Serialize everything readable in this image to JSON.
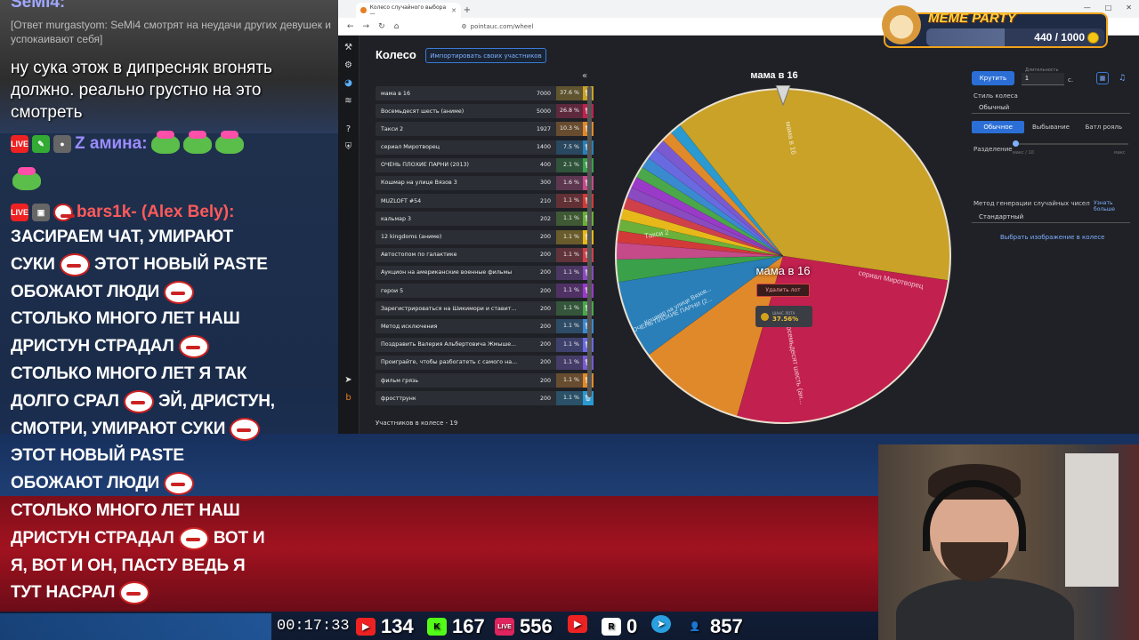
{
  "chat": {
    "top_user": "SeMi4:",
    "reply_text": "[Ответ murgastyom: SeMi4 смотрят на неудачи других девушек и успокаивают себя]",
    "message1": "ну сука этож в дипреcняк вгонять должно. реально грустно на это смотреть",
    "user2_name": "Z амина:",
    "user3_name": "bars1k- (Alex Bely):",
    "pasta_parts": [
      "ЗАСИРАЕМ ЧАТ, УМИРАЮТ СУКИ",
      "ЭТОТ НОВЫЙ PASTE ОБОЖАЮТ ЛЮДИ",
      "СТОЛЬКО МНОГО ЛЕТ НАШ ДРИСТУН СТРАДАЛ",
      "СТОЛЬКО МНОГО ЛЕТ Я ТАК ДОЛГО СРАЛ",
      "ЭЙ, ДРИСТУН, СМОТРИ, УМИРАЮТ СУКИ",
      "ЭТОТ НОВЫЙ PASTE ОБОЖАЮТ ЛЮДИ",
      "СТОЛЬКО МНОГО ЛЕТ НАШ ДРИСТУН СТРАДАЛ",
      "ВОТ И Я, ВОТ И ОН, ПАСТУ ВЕДЬ Я ТУТ НАСРАЛ"
    ]
  },
  "browser": {
    "tab_title": "Колесо случайного выбора —",
    "url": "pointauc.com/wheel"
  },
  "wheel_page": {
    "title": "Колесо",
    "import_button": "Импортировать своих участников",
    "participants_count": "Участников в колесе - 19",
    "lots": [
      {
        "name": "мама в 16",
        "value": "7000",
        "pct": "37.6 %",
        "color": "#c9a227"
      },
      {
        "name": "Восемьдесят шесть (аниме)",
        "value": "5000",
        "pct": "26.8 %",
        "color": "#c2204f"
      },
      {
        "name": "Такси 2",
        "value": "1927",
        "pct": "10.3 %",
        "color": "#e0892a"
      },
      {
        "name": "сериал Миротворец",
        "value": "1400",
        "pct": "7.5 %",
        "color": "#2a7fb8"
      },
      {
        "name": "ОЧЕНЬ ПЛОХИЕ ПАРНИ (2013)",
        "value": "400",
        "pct": "2.1 %",
        "color": "#3aa04a"
      },
      {
        "name": "Кошмар на улице Вязов 3",
        "value": "300",
        "pct": "1.6 %",
        "color": "#c44a8a"
      },
      {
        "name": "MUZLOFT #54",
        "value": "210",
        "pct": "1.1 %",
        "color": "#d23a3a"
      },
      {
        "name": "кальмар 3",
        "value": "202",
        "pct": "1.1 %",
        "color": "#6ab03a"
      },
      {
        "name": "12 kingdoms (аниме)",
        "value": "200",
        "pct": "1.1 %",
        "color": "#e6b81a"
      },
      {
        "name": "Автостопом по галактике",
        "value": "200",
        "pct": "1.1 %",
        "color": "#d0404a"
      },
      {
        "name": "Аукцион на американские военные фильмы",
        "value": "200",
        "pct": "1.1 %",
        "color": "#8a4ac0"
      },
      {
        "name": "герои 5",
        "value": "200",
        "pct": "1.1 %",
        "color": "#9a3ac8"
      },
      {
        "name": "Зарегистрироваться на Шикимори и ставит...",
        "value": "200",
        "pct": "1.1 %",
        "color": "#4aa84a"
      },
      {
        "name": "Метод исключения",
        "value": "200",
        "pct": "1.1 %",
        "color": "#3a8ad0"
      },
      {
        "name": "Поздравить Валерия Альбертовича Жмышe...",
        "value": "200",
        "pct": "1.1 %",
        "color": "#6a6ae0"
      },
      {
        "name": "Проиграйте, чтобы разбогатеть с самого на...",
        "value": "200",
        "pct": "1.1 %",
        "color": "#7a5ad0"
      },
      {
        "name": "фильм грязь",
        "value": "200",
        "pct": "1.1 %",
        "color": "#e08a2a"
      },
      {
        "name": "фросттрунк",
        "value": "200",
        "pct": "1.1 %",
        "color": "#2a9ad0"
      }
    ],
    "winner_label": "мама в 16",
    "pointer_label": "мама в 16",
    "delete_lot_button": "Удалить лот",
    "chance_label": "ШАНС ЛОТА",
    "chance_value": "37.56%",
    "slice_labels": {
      "taxi": "Такси 2",
      "mirotvorets": "сериал Миротворец",
      "eightysix": "Восемьдесят шесть (ан...",
      "mama": "мама в 16",
      "bad_guys": "ОЧЕНЬ ПЛОХИЕ ПАРНИ (2...",
      "nightmare": "Кошмар на улице Вязов..."
    }
  },
  "settings": {
    "spin_button": "Крутить",
    "duration_label": "Длительность",
    "duration_value": "1",
    "duration_unit": "с.",
    "style_label": "Стиль колеса",
    "style_value": "Обычный",
    "modes": [
      "Обычное",
      "Выбывание",
      "Батл рояль"
    ],
    "split_label": "Разделение",
    "split_hint_left": "макс / 10",
    "split_hint_right": "макс",
    "rng_label": "Метод генерации случайных чисел",
    "rng_more": "Узнать больше",
    "rng_value": "Стандартный",
    "choose_image": "Выбрать изображение в колесе"
  },
  "meme_party": {
    "title": "MEME PARTY",
    "count": "440 / 1000",
    "progress": 0.44
  },
  "stats": {
    "time": "00:17:33",
    "youtube": "134",
    "kick": "167",
    "vk": "556",
    "vk_label": "LIVE",
    "play": "",
    "r_label": "R",
    "r": "0",
    "viewers": "857"
  },
  "colors": {
    "accent": "#2b6fd6",
    "wheel_gold": "#c9a227",
    "wheel_crimson": "#c2204f",
    "wheel_orange": "#e0892a",
    "wheel_blue": "#2a7fb8"
  }
}
